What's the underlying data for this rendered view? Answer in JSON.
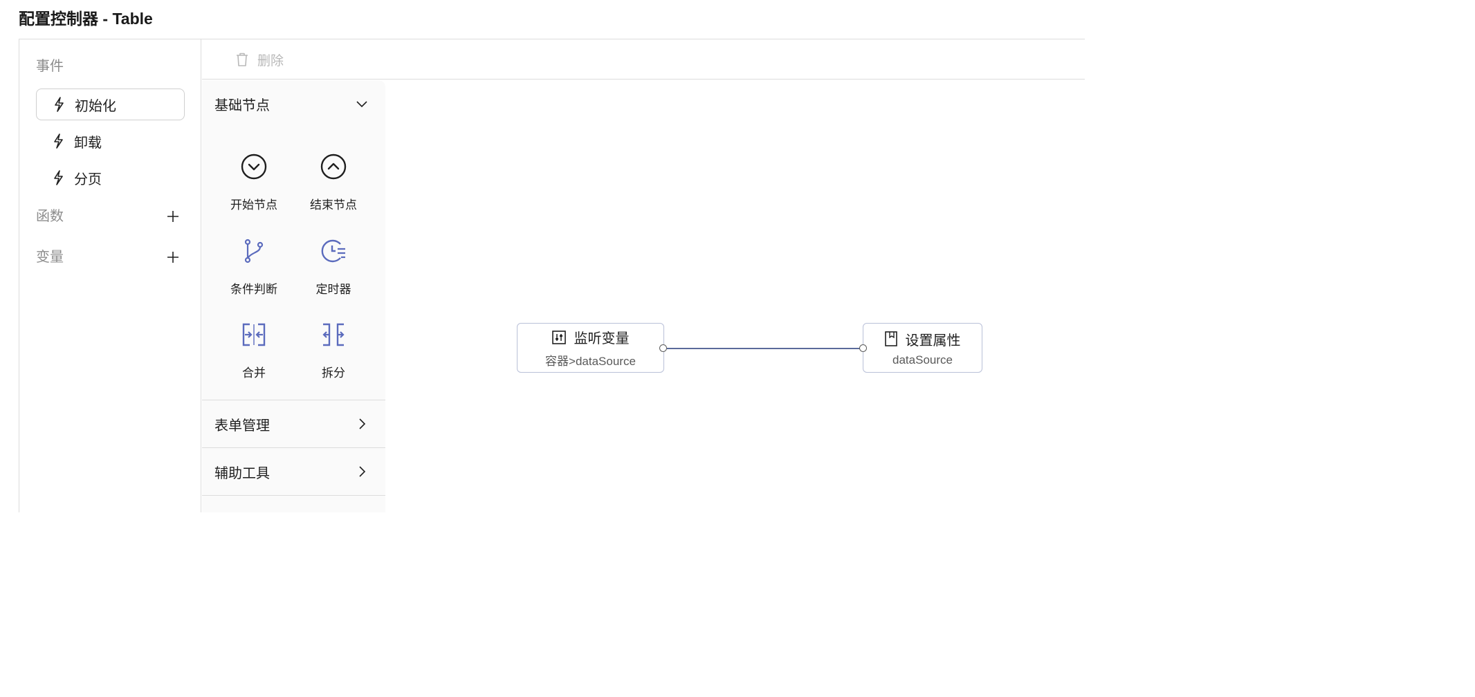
{
  "title": "配置控制器 - Table",
  "sidebar": {
    "events_label": "事件",
    "events": [
      {
        "label": "初始化",
        "selected": true
      },
      {
        "label": "卸载",
        "selected": false
      },
      {
        "label": "分页",
        "selected": false
      }
    ],
    "functions_label": "函数",
    "variables_label": "变量"
  },
  "toolbar": {
    "delete_label": "删除",
    "delete_icon": "trash-icon"
  },
  "palette": {
    "groups": [
      {
        "label": "基础节点",
        "expanded": true,
        "tools": [
          {
            "label": "开始节点",
            "icon": "chevron-down-circle-icon"
          },
          {
            "label": "结束节点",
            "icon": "chevron-up-circle-icon"
          },
          {
            "label": "条件判断",
            "icon": "branch-icon"
          },
          {
            "label": "定时器",
            "icon": "clock-icon"
          },
          {
            "label": "合并",
            "icon": "merge-icon"
          },
          {
            "label": "拆分",
            "icon": "split-icon"
          }
        ]
      },
      {
        "label": "表单管理",
        "expanded": false
      },
      {
        "label": "辅助工具",
        "expanded": false
      }
    ]
  },
  "canvas": {
    "nodes": [
      {
        "title": "监听变量",
        "subtitle": "容器>dataSource",
        "icon": "sliders-icon"
      },
      {
        "title": "设置属性",
        "subtitle": "dataSource",
        "icon": "page-icon"
      }
    ]
  },
  "colors": {
    "accent_icon": "#5b6bbd",
    "edge": "#5a6a9a",
    "node_border": "#b9c0d8"
  }
}
